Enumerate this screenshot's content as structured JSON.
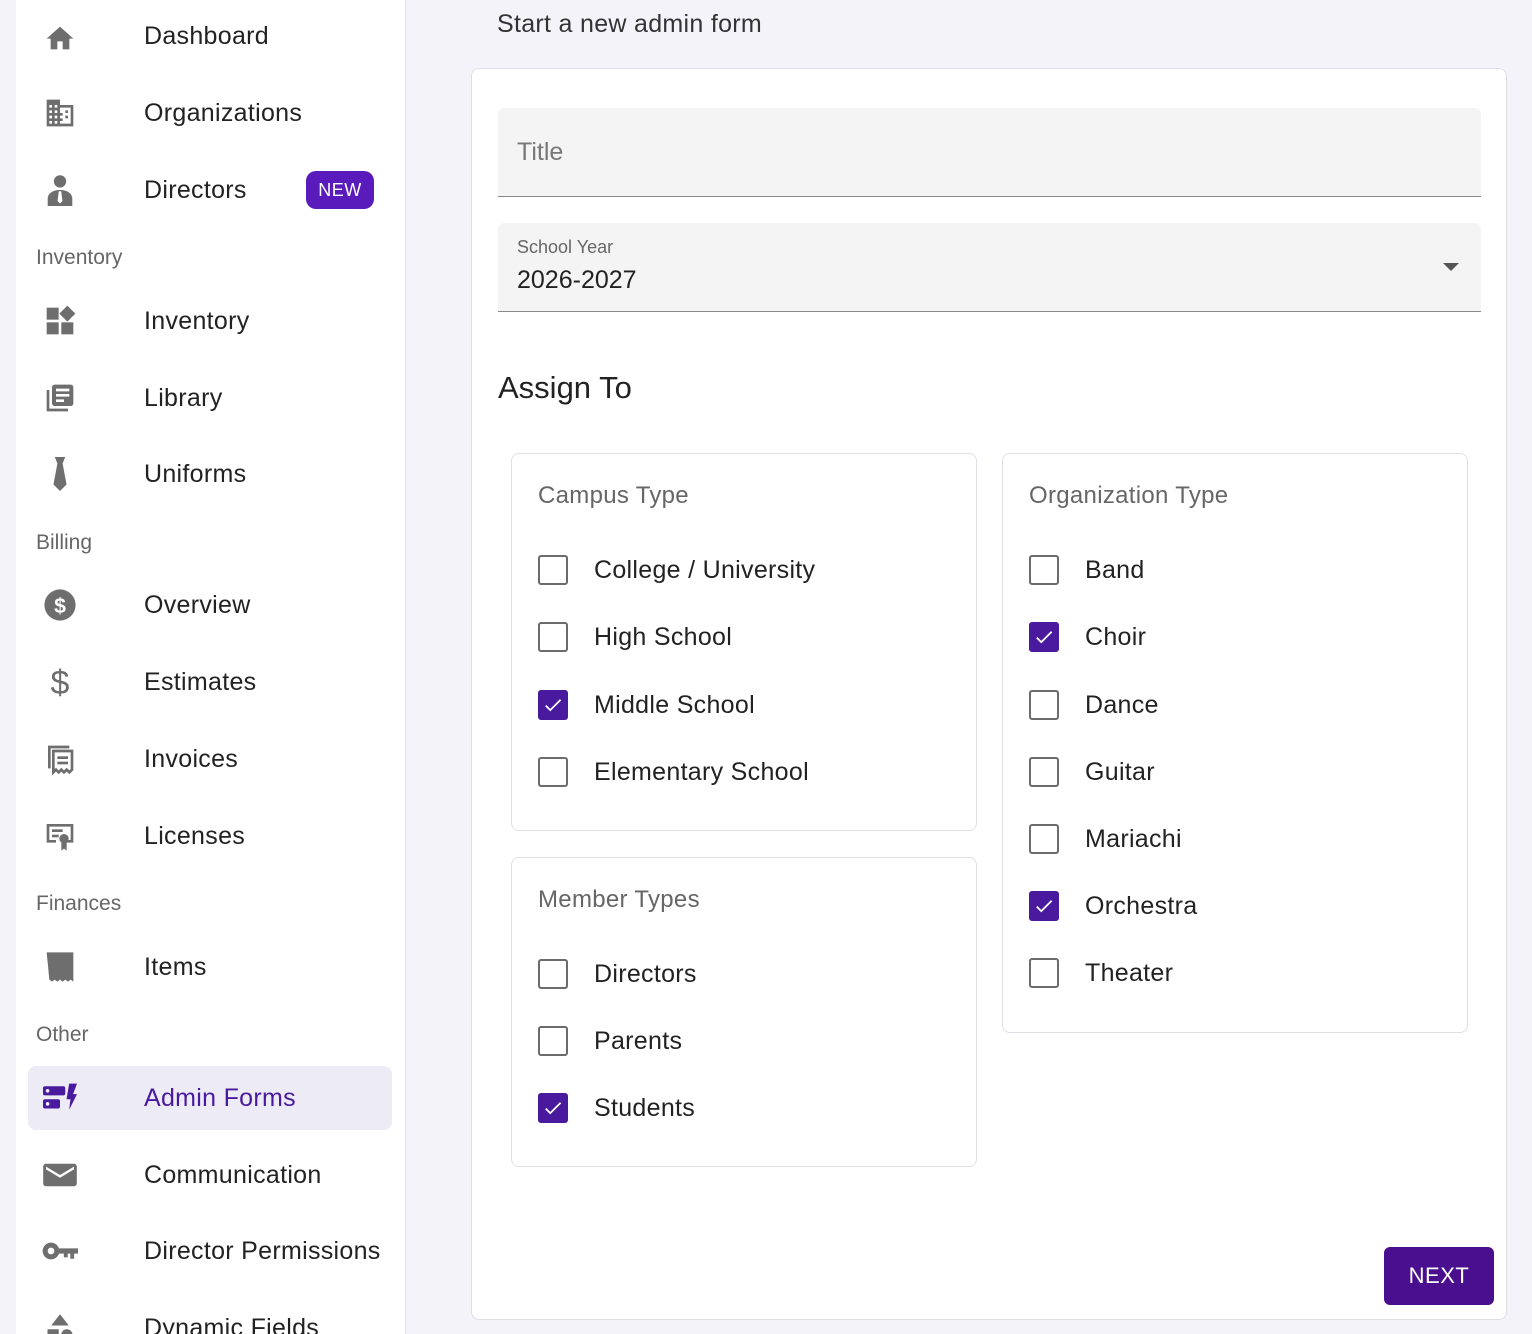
{
  "page_heading": "Start a new admin form",
  "sidebar": {
    "items": [
      {
        "label": "Dashboard",
        "icon": "home-icon"
      },
      {
        "label": "Organizations",
        "icon": "building-icon"
      },
      {
        "label": "Directors",
        "icon": "person-icon",
        "badge": "NEW"
      },
      {
        "label": "Inventory",
        "icon": "widgets-icon"
      },
      {
        "label": "Library",
        "icon": "library-icon"
      },
      {
        "label": "Uniforms",
        "icon": "tie-icon"
      },
      {
        "label": "Overview",
        "icon": "dollar-circle-icon"
      },
      {
        "label": "Estimates",
        "icon": "dollar-icon"
      },
      {
        "label": "Invoices",
        "icon": "receipt-icon"
      },
      {
        "label": "Licenses",
        "icon": "license-icon"
      },
      {
        "label": "Items",
        "icon": "ticket-icon"
      },
      {
        "label": "Admin Forms",
        "icon": "dynamic-form-icon",
        "active": true
      },
      {
        "label": "Communication",
        "icon": "mail-icon"
      },
      {
        "label": "Director Permissions",
        "icon": "key-icon"
      },
      {
        "label": "Dynamic Fields",
        "icon": "shapes-icon"
      }
    ],
    "sections": [
      "Inventory",
      "Billing",
      "Finances",
      "Other"
    ]
  },
  "form": {
    "title_placeholder": "Title",
    "school_year_label": "School Year",
    "school_year_value": "2026-2027",
    "assign_title": "Assign To",
    "campus": {
      "title": "Campus Type",
      "options": [
        {
          "label": "College / University",
          "checked": false
        },
        {
          "label": "High School",
          "checked": false
        },
        {
          "label": "Middle School",
          "checked": true
        },
        {
          "label": "Elementary School",
          "checked": false
        }
      ]
    },
    "members": {
      "title": "Member Types",
      "options": [
        {
          "label": "Directors",
          "checked": false
        },
        {
          "label": "Parents",
          "checked": false
        },
        {
          "label": "Students",
          "checked": true
        }
      ]
    },
    "organization": {
      "title": "Organization Type",
      "options": [
        {
          "label": "Band",
          "checked": false
        },
        {
          "label": "Choir",
          "checked": true
        },
        {
          "label": "Dance",
          "checked": false
        },
        {
          "label": "Guitar",
          "checked": false
        },
        {
          "label": "Mariachi",
          "checked": false
        },
        {
          "label": "Orchestra",
          "checked": true
        },
        {
          "label": "Theater",
          "checked": false
        }
      ]
    },
    "next_label": "NEXT"
  },
  "colors": {
    "accent": "#4a1a9e",
    "badge": "#5a1bbd",
    "button": "#4a0f8f"
  }
}
